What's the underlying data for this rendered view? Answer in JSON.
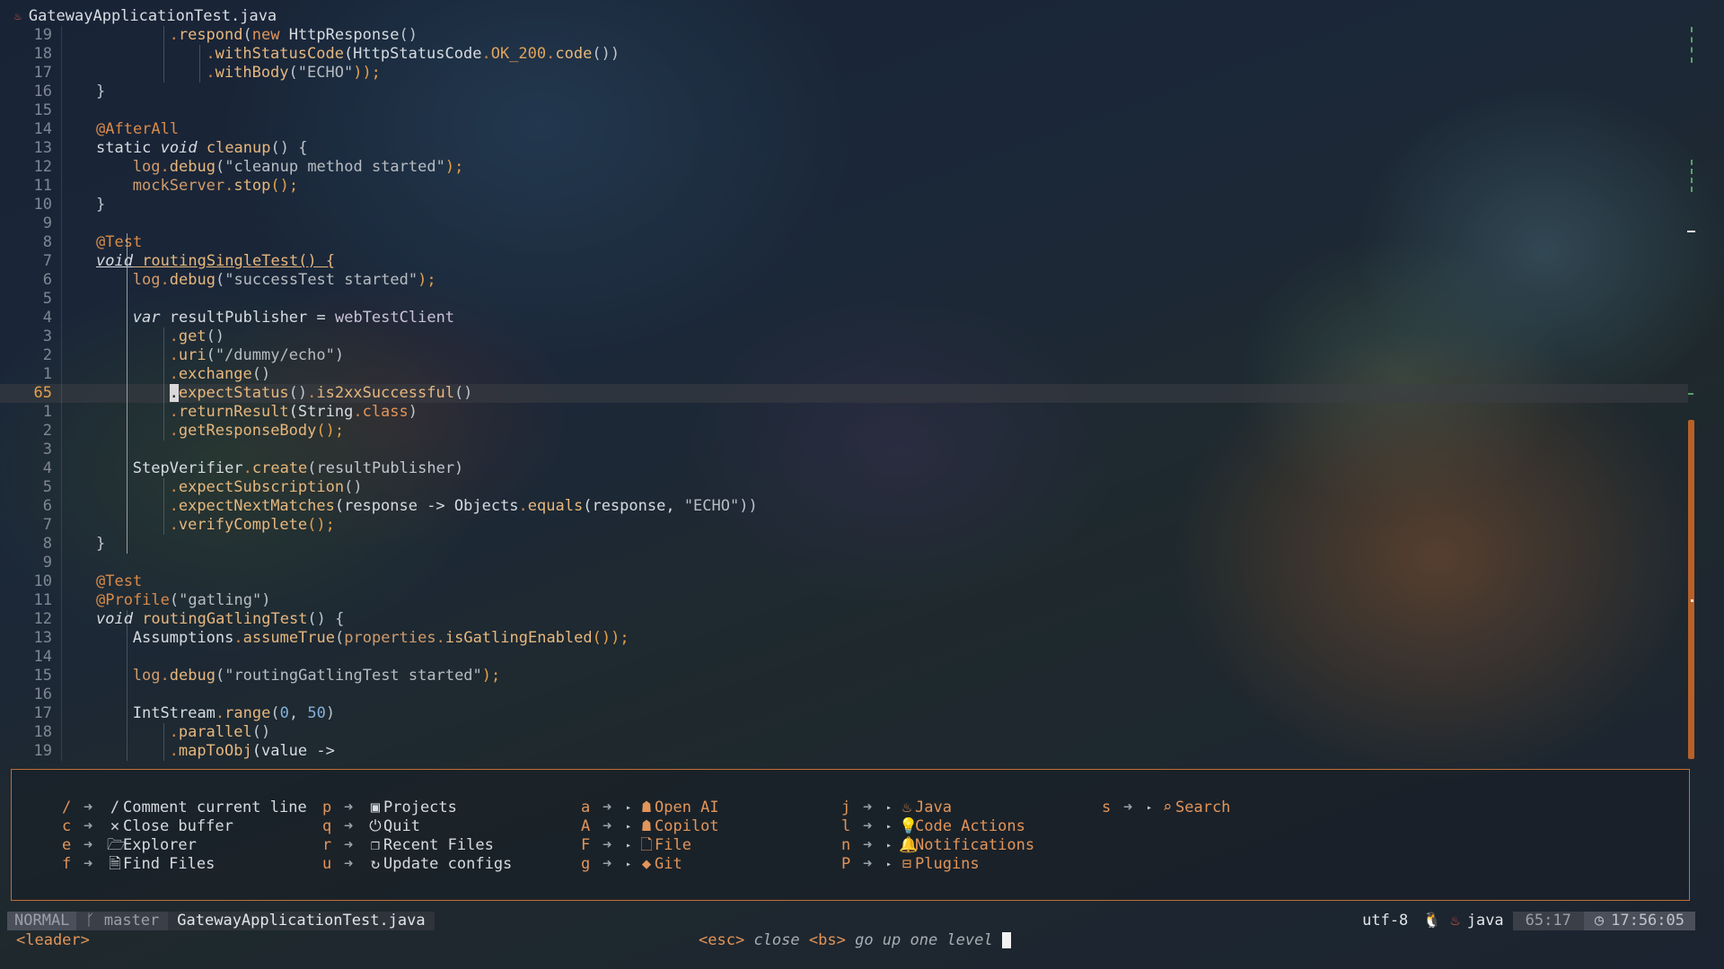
{
  "window": {
    "file_icon": "java-icon",
    "title": "GatewayApplicationTest.java"
  },
  "editor": {
    "lines": [
      {
        "n": "19",
        "ind": 2,
        "toks": [
          [
            ".",
            "dot"
          ],
          [
            "respond",
            "fn"
          ],
          [
            "(",
            "punc"
          ],
          [
            "new",
            "kw"
          ],
          [
            " HttpResponse",
            "plain"
          ],
          [
            "()",
            "punc"
          ]
        ]
      },
      {
        "n": "18",
        "ind": 3,
        "toks": [
          [
            ".",
            "dot"
          ],
          [
            "withStatusCode",
            "fn"
          ],
          [
            "(HttpStatusCode",
            "plain"
          ],
          [
            ".",
            "dot"
          ],
          [
            "OK_200",
            "const"
          ],
          [
            ".",
            "dot"
          ],
          [
            "code",
            "fn"
          ],
          [
            "())",
            "punc"
          ]
        ]
      },
      {
        "n": "17",
        "ind": 3,
        "toks": [
          [
            ".",
            "dot"
          ],
          [
            "withBody",
            "fn"
          ],
          [
            "(",
            "punc"
          ],
          [
            "\"ECHO\"",
            "str"
          ],
          [
            "));",
            "semi"
          ]
        ]
      },
      {
        "n": "16",
        "ind": 0,
        "toks": [
          [
            "}",
            "punc"
          ]
        ]
      },
      {
        "n": "15",
        "ind": 0,
        "toks": []
      },
      {
        "n": "14",
        "ind": 0,
        "toks": [
          [
            "@AfterAll",
            "ann"
          ]
        ]
      },
      {
        "n": "13",
        "ind": 0,
        "toks": [
          [
            "static ",
            "plain"
          ],
          [
            "void",
            "kwi"
          ],
          [
            " cleanup",
            "fn"
          ],
          [
            "() {",
            "punc"
          ]
        ]
      },
      {
        "n": "12",
        "ind": 1,
        "toks": [
          [
            "log",
            "var"
          ],
          [
            ".",
            "dot"
          ],
          [
            "debug",
            "fn"
          ],
          [
            "(",
            "punc"
          ],
          [
            "\"cleanup method started\"",
            "str"
          ],
          [
            ");",
            "semi"
          ]
        ]
      },
      {
        "n": "11",
        "ind": 1,
        "toks": [
          [
            "mockServer",
            "var"
          ],
          [
            ".",
            "dot"
          ],
          [
            "stop",
            "fn"
          ],
          [
            "();",
            "semi"
          ]
        ]
      },
      {
        "n": "10",
        "ind": 0,
        "toks": [
          [
            "}",
            "punc"
          ]
        ]
      },
      {
        "n": "9",
        "ind": 0,
        "toks": []
      },
      {
        "n": "8",
        "ind": 0,
        "toks": [
          [
            "@Test",
            "ann"
          ]
        ]
      },
      {
        "n": "7",
        "ind": 0,
        "toks": [
          [
            "void",
            "kwi-u"
          ],
          [
            " routingSingleTest() {",
            "fn-u"
          ]
        ]
      },
      {
        "n": "6",
        "ind": 1,
        "toks": [
          [
            "log",
            "var"
          ],
          [
            ".",
            "dot"
          ],
          [
            "debug",
            "fn"
          ],
          [
            "(",
            "punc"
          ],
          [
            "\"successTest started\"",
            "str"
          ],
          [
            ");",
            "semi"
          ]
        ]
      },
      {
        "n": "5",
        "ind": 0,
        "toks": []
      },
      {
        "n": "4",
        "ind": 1,
        "toks": [
          [
            "var",
            "kwi"
          ],
          [
            " resultPublisher = ",
            "plain"
          ],
          [
            "webTestClient",
            "id"
          ]
        ]
      },
      {
        "n": "3",
        "ind": 2,
        "toks": [
          [
            ".",
            "dot"
          ],
          [
            "get",
            "fn"
          ],
          [
            "()",
            "punc"
          ]
        ]
      },
      {
        "n": "2",
        "ind": 2,
        "toks": [
          [
            ".",
            "dot"
          ],
          [
            "uri",
            "fn"
          ],
          [
            "(",
            "punc"
          ],
          [
            "\"/dummy/echo\"",
            "str"
          ],
          [
            ")",
            "punc"
          ]
        ]
      },
      {
        "n": "1",
        "ind": 2,
        "toks": [
          [
            ".",
            "dot"
          ],
          [
            "exchange",
            "fn"
          ],
          [
            "()",
            "punc"
          ]
        ]
      },
      {
        "n": "65",
        "ind": 2,
        "cur": true,
        "toks": [
          [
            ".",
            "cursor"
          ],
          [
            "expectStatus",
            "fn"
          ],
          [
            "()",
            "punc"
          ],
          [
            ".",
            "dot"
          ],
          [
            "is2xxSuccessful",
            "fn"
          ],
          [
            "()",
            "punc"
          ]
        ]
      },
      {
        "n": "1",
        "ind": 2,
        "toks": [
          [
            ".",
            "dot"
          ],
          [
            "returnResult",
            "fn"
          ],
          [
            "(String",
            "plain"
          ],
          [
            ".",
            "dot"
          ],
          [
            "class",
            "kw"
          ],
          [
            ")",
            "punc"
          ]
        ]
      },
      {
        "n": "2",
        "ind": 2,
        "toks": [
          [
            ".",
            "dot"
          ],
          [
            "getResponseBody",
            "fn"
          ],
          [
            "();",
            "semi"
          ]
        ]
      },
      {
        "n": "3",
        "ind": 0,
        "toks": []
      },
      {
        "n": "4",
        "ind": 1,
        "toks": [
          [
            "StepVerifier",
            "plain"
          ],
          [
            ".",
            "dot"
          ],
          [
            "create",
            "fn"
          ],
          [
            "(resultPublisher)",
            "punc"
          ]
        ]
      },
      {
        "n": "5",
        "ind": 2,
        "toks": [
          [
            ".",
            "dot"
          ],
          [
            "expectSubscription",
            "fn"
          ],
          [
            "()",
            "punc"
          ]
        ]
      },
      {
        "n": "6",
        "ind": 2,
        "toks": [
          [
            ".",
            "dot"
          ],
          [
            "expectNextMatches",
            "fn"
          ],
          [
            "(response -> Objects",
            "plain"
          ],
          [
            ".",
            "dot"
          ],
          [
            "equals",
            "fn"
          ],
          [
            "(response, ",
            "plain"
          ],
          [
            "\"ECHO\"",
            "str"
          ],
          [
            "))",
            "punc"
          ]
        ]
      },
      {
        "n": "7",
        "ind": 2,
        "toks": [
          [
            ".",
            "dot"
          ],
          [
            "verifyComplete",
            "fn"
          ],
          [
            "();",
            "semi"
          ]
        ]
      },
      {
        "n": "8",
        "ind": 0,
        "toks": [
          [
            "}",
            "punc"
          ]
        ]
      },
      {
        "n": "9",
        "ind": 0,
        "toks": []
      },
      {
        "n": "10",
        "ind": 0,
        "toks": [
          [
            "@Test",
            "ann"
          ]
        ]
      },
      {
        "n": "11",
        "ind": 0,
        "toks": [
          [
            "@Profile",
            "ann"
          ],
          [
            "(",
            "punc"
          ],
          [
            "\"gatling\"",
            "str"
          ],
          [
            ")",
            "punc"
          ]
        ]
      },
      {
        "n": "12",
        "ind": 0,
        "toks": [
          [
            "void",
            "kwi"
          ],
          [
            " routingGatlingTest",
            "fn"
          ],
          [
            "() {",
            "punc"
          ]
        ]
      },
      {
        "n": "13",
        "ind": 1,
        "toks": [
          [
            "Assumptions",
            "plain"
          ],
          [
            ".",
            "dot"
          ],
          [
            "assumeTrue",
            "fn"
          ],
          [
            "(",
            "punc"
          ],
          [
            "properties",
            "var"
          ],
          [
            ".",
            "dot"
          ],
          [
            "isGatlingEnabled",
            "fn"
          ],
          [
            "());",
            "semi"
          ]
        ]
      },
      {
        "n": "14",
        "ind": 0,
        "toks": []
      },
      {
        "n": "15",
        "ind": 1,
        "toks": [
          [
            "log",
            "var"
          ],
          [
            ".",
            "dot"
          ],
          [
            "debug",
            "fn"
          ],
          [
            "(",
            "punc"
          ],
          [
            "\"routingGatlingTest started\"",
            "str"
          ],
          [
            ");",
            "semi"
          ]
        ]
      },
      {
        "n": "16",
        "ind": 0,
        "toks": []
      },
      {
        "n": "17",
        "ind": 1,
        "toks": [
          [
            "IntStream",
            "plain"
          ],
          [
            ".",
            "dot"
          ],
          [
            "range",
            "fn"
          ],
          [
            "(",
            "punc"
          ],
          [
            "0",
            "num"
          ],
          [
            ", ",
            "punc"
          ],
          [
            "50",
            "num"
          ],
          [
            ")",
            "punc"
          ]
        ]
      },
      {
        "n": "18",
        "ind": 2,
        "toks": [
          [
            ".",
            "dot"
          ],
          [
            "parallel",
            "fn"
          ],
          [
            "()",
            "punc"
          ]
        ]
      },
      {
        "n": "19",
        "ind": 2,
        "toks": [
          [
            ".",
            "dot"
          ],
          [
            "mapToObj",
            "fn"
          ],
          [
            "(value ->",
            "plain"
          ]
        ]
      }
    ]
  },
  "which_key": {
    "columns": [
      [
        {
          "key": "/",
          "icon": "/",
          "icon_name": "comment-icon",
          "label": "Comment current line",
          "group": false
        },
        {
          "key": "c",
          "icon": "✕",
          "icon_name": "close-icon",
          "label": "Close buffer",
          "group": false
        },
        {
          "key": "e",
          "icon": "🗁",
          "icon_name": "folder-icon",
          "label": "Explorer",
          "group": false
        },
        {
          "key": "f",
          "icon": "🗎",
          "icon_name": "file-search-icon",
          "label": "Find Files",
          "group": false
        }
      ],
      [
        {
          "key": "p",
          "icon": "▣",
          "icon_name": "projects-icon",
          "label": "Projects",
          "group": false
        },
        {
          "key": "q",
          "icon": "⏻",
          "icon_name": "quit-icon",
          "label": "Quit",
          "group": false
        },
        {
          "key": "r",
          "icon": "❐",
          "icon_name": "recent-files-icon",
          "label": "Recent Files",
          "group": false
        },
        {
          "key": "u",
          "icon": "↻",
          "icon_name": "refresh-icon",
          "label": "Update configs",
          "group": false
        }
      ],
      [
        {
          "key": "a",
          "icon": "☗",
          "icon_name": "robot-icon",
          "label": "Open AI",
          "group": true
        },
        {
          "key": "A",
          "icon": "☗",
          "icon_name": "copilot-icon",
          "label": "Copilot",
          "group": true
        },
        {
          "key": "F",
          "icon": "🗋",
          "icon_name": "file-icon",
          "label": "File",
          "group": true
        },
        {
          "key": "g",
          "icon": "◆",
          "icon_name": "git-icon",
          "label": "Git",
          "group": true
        }
      ],
      [
        {
          "key": "j",
          "icon": "♨",
          "icon_name": "java-icon",
          "label": "Java",
          "group": true
        },
        {
          "key": "l",
          "icon": "💡",
          "icon_name": "lightbulb-icon",
          "label": "Code Actions",
          "group": true
        },
        {
          "key": "n",
          "icon": "🔔",
          "icon_name": "bell-icon",
          "label": "Notifications",
          "group": true
        },
        {
          "key": "P",
          "icon": "⊟",
          "icon_name": "plugin-icon",
          "label": "Plugins",
          "group": true
        }
      ],
      [
        {
          "key": "s",
          "icon": "⌕",
          "icon_name": "search-icon",
          "label": "Search",
          "group": true
        }
      ]
    ],
    "arrow": "➜",
    "sub": "▸"
  },
  "statusline": {
    "mode": "NORMAL",
    "branch_icon": "git-branch-icon",
    "branch": "master",
    "filename": "GatewayApplicationTest.java",
    "encoding": "utf-8",
    "os_icon": "linux-icon",
    "filetype_icon": "java-icon",
    "filetype": "java",
    "position": "65:17",
    "clock_icon": "clock-icon",
    "time": "17:56:05"
  },
  "cmdline": {
    "leader": "<leader>",
    "esc_key": "<esc>",
    "esc_desc": "close",
    "bs_key": "<bs>",
    "bs_desc": "go up one level"
  },
  "colors": {
    "accent": "#e2955a",
    "border": "#c36e34",
    "scrollbar": "#b8602a"
  }
}
